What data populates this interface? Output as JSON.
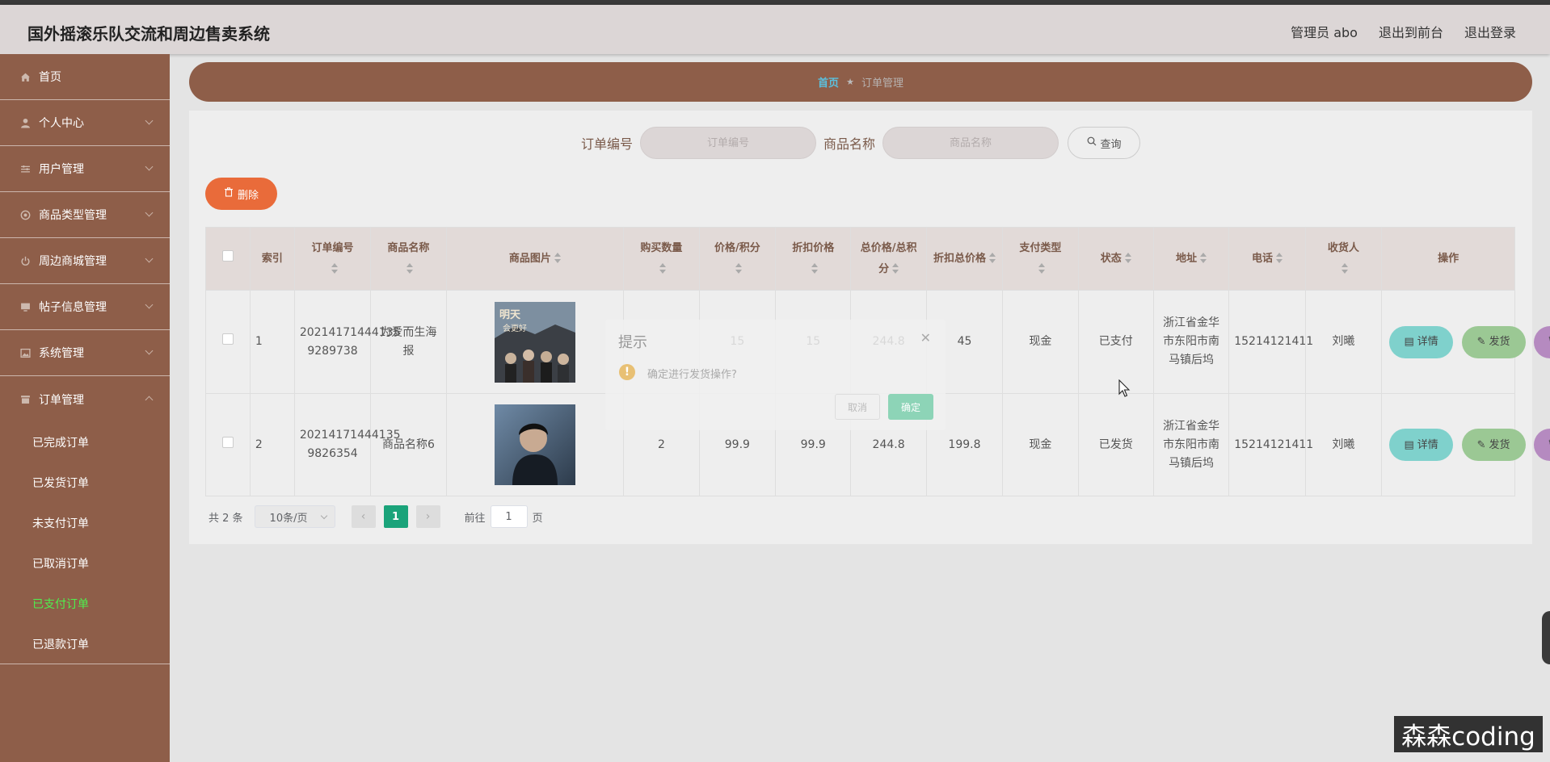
{
  "app": {
    "title": "国外摇滚乐队交流和周边售卖系统",
    "nav": [
      "管理员 abo",
      "退出到前台",
      "退出登录"
    ]
  },
  "sidebar": {
    "items": [
      {
        "label": "首页",
        "icon": "home-icon"
      },
      {
        "label": "个人中心",
        "icon": "user-icon"
      },
      {
        "label": "用户管理",
        "icon": "users-icon"
      },
      {
        "label": "商品类型管理",
        "icon": "settings-icon"
      },
      {
        "label": "周边商城管理",
        "icon": "power-icon"
      },
      {
        "label": "帖子信息管理",
        "icon": "monitor-icon"
      },
      {
        "label": "系统管理",
        "icon": "picture-icon"
      },
      {
        "label": "订单管理",
        "icon": "box-icon"
      }
    ],
    "subitems": [
      "已完成订单",
      "已发货订单",
      "未支付订单",
      "已取消订单",
      "已支付订单",
      "已退款订单"
    ],
    "active_subitem": "已支付订单"
  },
  "breadcrumb": {
    "home": "首页",
    "current": "订单管理"
  },
  "search": {
    "order_no_label": "订单编号",
    "order_no_placeholder": "订单编号",
    "product_label": "商品名称",
    "product_placeholder": "商品名称",
    "query_label": "查询"
  },
  "actions": {
    "delete_label": "删除"
  },
  "table": {
    "headers": [
      "索引",
      "订单编号",
      "商品名称",
      "商品图片",
      "购买数量",
      "价格/积分",
      "折扣价格",
      "总价格/总积分",
      "折扣总价格",
      "支付类型",
      "状态",
      "地址",
      "电话",
      "收货人",
      "操作"
    ],
    "rows": [
      {
        "index": "1",
        "order_no": "20214171444135 9289738",
        "product": "为爱而生海报",
        "image": "poster-image",
        "qty": "",
        "price": "15",
        "discount_price": "15",
        "total": "244.8",
        "discount_total": "45",
        "pay_type": "现金",
        "status": "已支付",
        "address": "浙江省金华市东阳市南马镇后坞",
        "phone": "15214121411",
        "receiver": "刘曦"
      },
      {
        "index": "2",
        "order_no": "20214171444135 9826354",
        "product": "商品名称6",
        "image": "portrait-image",
        "qty": "2",
        "price": "99.9",
        "discount_price": "99.9",
        "total": "244.8",
        "discount_total": "199.8",
        "pay_type": "现金",
        "status": "已发货",
        "address": "浙江省金华市东阳市南马镇后坞",
        "phone": "15214121411",
        "receiver": "刘曦"
      }
    ],
    "ops": {
      "detail": "详情",
      "ship": "发货",
      "delete": "删除"
    }
  },
  "pagination": {
    "total": "共 2 条",
    "page_size": "10条/页",
    "current_page": "1",
    "goto_prefix": "前往",
    "goto_value": "1",
    "goto_suffix": "页"
  },
  "dialog": {
    "title": "提示",
    "message": "确定进行发货操作?",
    "cancel": "取消",
    "confirm": "确定"
  },
  "watermark": "森森coding",
  "colors": {
    "header_bg": "#dcd6d6",
    "sidebar_bg": "#8e5e49",
    "accent_orange": "#e96b3a",
    "detail_btn": "#7fd1cc",
    "ship_btn": "#9bc894",
    "delete_btn": "#b58ac0",
    "page_active": "#1aa37a",
    "active_menu_text": "#4ef04e"
  }
}
